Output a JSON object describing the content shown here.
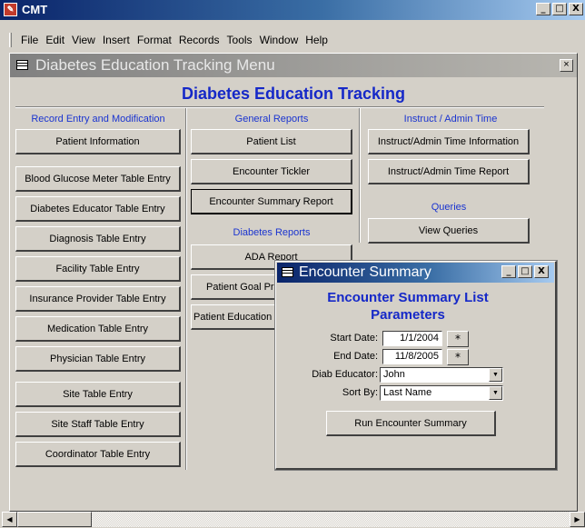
{
  "app": {
    "title": "CMT",
    "icon": "app-icon",
    "caption_buttons": [
      "_",
      "□",
      "X"
    ]
  },
  "menu": [
    "File",
    "Edit",
    "View",
    "Insert",
    "Format",
    "Records",
    "Tools",
    "Window",
    "Help"
  ],
  "form": {
    "title": "Diabetes Education Tracking Menu",
    "heading": "Diabetes Education Tracking",
    "close_glyph": "×",
    "col1_header": "Record Entry and Modification",
    "col2_header": "General Reports",
    "col3_header": "Instruct / Admin Time",
    "col2_sub_header": "Diabetes Reports",
    "col3_sub_header": "Queries",
    "col1_buttons": [
      "Patient Information",
      "Blood Glucose Meter Table Entry",
      "Diabetes Educator Table Entry",
      "Diagnosis Table Entry",
      "Facility Table Entry",
      "Insurance Provider Table Entry",
      "Medication Table Entry",
      "Physician Table Entry",
      "Site Table Entry",
      "Site Staff Table Entry",
      "Coordinator Table Entry"
    ],
    "col2_buttons": [
      "Patient List",
      "Encounter Tickler",
      "Encounter Summary Report"
    ],
    "col2_report_buttons": [
      "ADA Report",
      "Patient Goal Progress",
      "Patient Education"
    ],
    "col3_buttons": [
      "Instruct/Admin Time Information",
      "Instruct/Admin Time Report"
    ],
    "col3_query_button": "View Queries"
  },
  "encounter_summary": {
    "title": "Encounter Summary",
    "heading_line1": "Encounter Summary List",
    "heading_line2": "Parameters",
    "start_date_label": "Start Date:",
    "start_date_value": "1/1/2004",
    "end_date_label": "End Date:",
    "end_date_value": "11/8/2005",
    "educator_label": "Diab Educator:",
    "educator_value": "John",
    "sort_label": "Sort By:",
    "sort_value": "Last Name",
    "calendar_button": "*",
    "run_button": "Run Encounter Summary"
  },
  "scrollbar": {
    "left_arrow": "◀",
    "right_arrow": "▶"
  },
  "colors": {
    "heading_blue": "#1528c8",
    "active_title": "#0a246a",
    "inactive_title": "#808080"
  }
}
